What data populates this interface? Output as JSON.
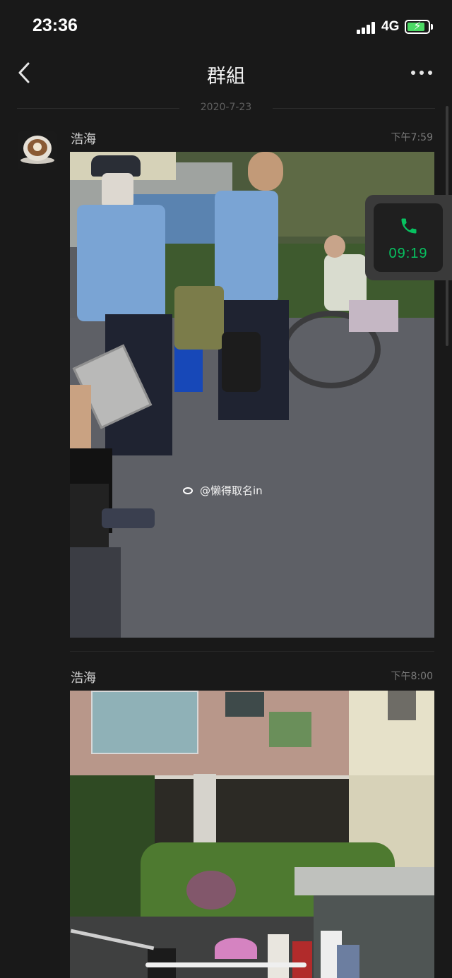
{
  "status_bar": {
    "time": "23:36",
    "network": "4G",
    "battery_icon": "battery-charging-icon",
    "signal_icon": "signal-icon"
  },
  "nav": {
    "title": "群組",
    "back_icon": "chevron-left-icon",
    "more_icon": "more-icon"
  },
  "chat": {
    "date_separator": "2020-7-23",
    "messages": [
      {
        "sender": "浩海",
        "time": "下午7:59",
        "type": "image",
        "watermark": "@懒得取名in"
      },
      {
        "sender": "浩海",
        "time": "下午8:00",
        "type": "image"
      }
    ]
  },
  "call_float": {
    "duration": "09:19",
    "icon": "phone-icon",
    "accent": "#07c160"
  },
  "colors": {
    "background": "#191919",
    "accent_green": "#07c160",
    "battery_green": "#4cd964"
  }
}
